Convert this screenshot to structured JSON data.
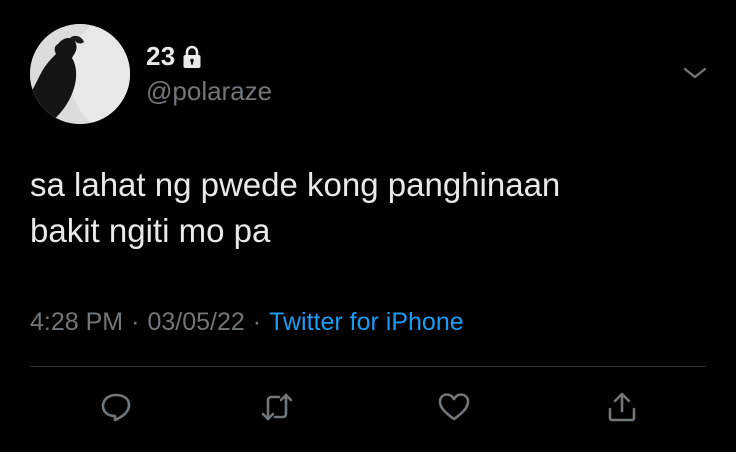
{
  "tweet": {
    "display_name": "23",
    "handle": "@polaraze",
    "protected_icon": "lock-icon",
    "text_lines": [
      "sa lahat ng pwede kong panghinaan",
      "bakit ngiti mo pa"
    ],
    "time": "4:28 PM",
    "separator": "·",
    "date": "03/05/22",
    "source": "Twitter for iPhone"
  },
  "actions": {
    "reply_icon": "reply-icon",
    "retweet_icon": "retweet-icon",
    "like_icon": "heart-icon",
    "share_icon": "share-icon",
    "more_icon": "chevron-down-icon"
  },
  "colors": {
    "background": "#000000",
    "text_primary": "#e7e9ea",
    "text_secondary": "#71767b",
    "link": "#1d9bf0",
    "divider": "#2f3336"
  }
}
